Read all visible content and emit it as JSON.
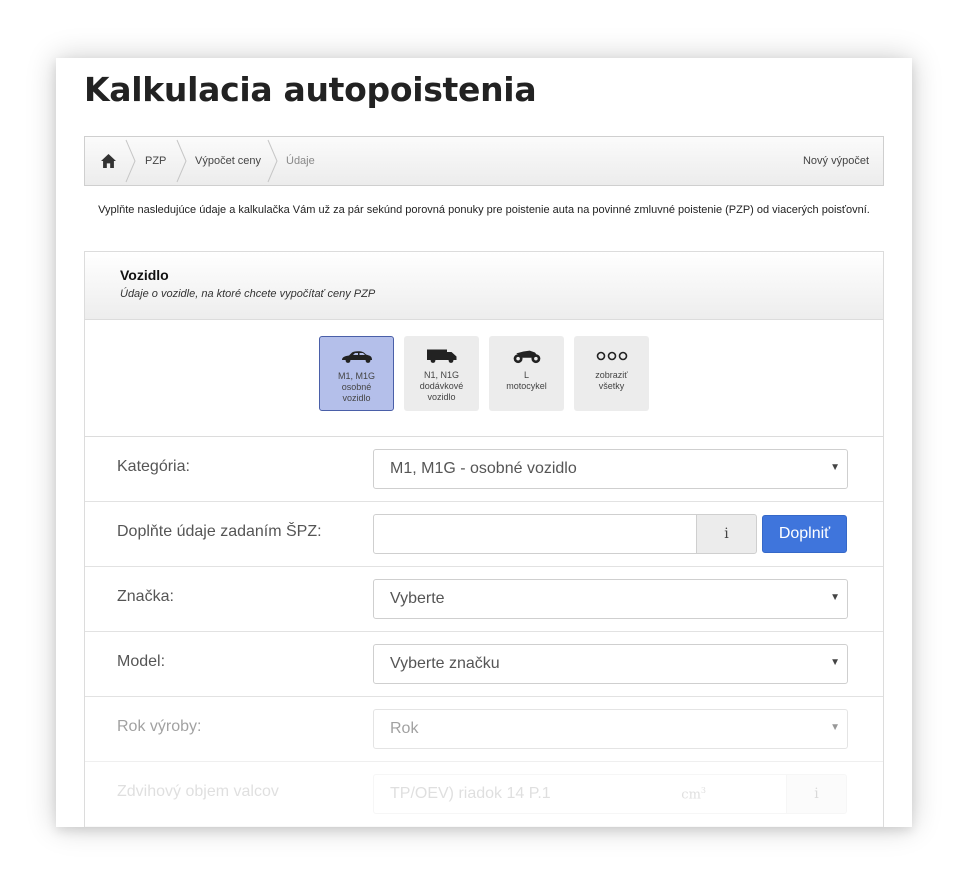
{
  "page": {
    "title": "Kalkulacia autopoistenia"
  },
  "breadcrumb": {
    "items": [
      "PZP",
      "Výpočet ceny",
      "Údaje"
    ],
    "new_calc": "Nový výpočet"
  },
  "intro": "Vyplňte nasledujúce údaje a kalkulačka Vám už za pár sekúnd porovná ponuky pre poistenie auta na povinné zmluvné poistenie (PZP) od viacerých poisťovní.",
  "section": {
    "title": "Vozidlo",
    "subtitle": "Údaje o vozidle, na ktoré chcete vypočítať ceny PZP"
  },
  "vehicle_types": [
    {
      "line1": "M1, M1G",
      "line2": "osobné",
      "line3": "vozidlo",
      "icon": "car-icon",
      "active": true
    },
    {
      "line1": "N1, N1G",
      "line2": "dodávkové",
      "line3": "vozidlo",
      "icon": "van-icon",
      "active": false
    },
    {
      "line1": "L",
      "line2": "motocykel",
      "line3": "",
      "icon": "motorcycle-icon",
      "active": false
    },
    {
      "line1": "zobraziť",
      "line2": "všetky",
      "line3": "",
      "icon": "more-icon",
      "active": false
    }
  ],
  "form": {
    "category_label": "Kategória:",
    "category_value": "M1, M1G - osobné vozidlo",
    "spz_label": "Doplňte údaje zadaním ŠPZ:",
    "spz_value": "",
    "info_button": "i",
    "fill_button": "Doplniť",
    "brand_label": "Značka:",
    "brand_value": "Vyberte",
    "model_label": "Model:",
    "model_value": "Vyberte značku",
    "year_label": "Rok výroby:",
    "year_value": "Rok",
    "engine_label": "Zdvihový objem valcov",
    "engine_placeholder": "TP/OEV) riadok 14 P.1",
    "engine_unit": "cm",
    "engine_unit_sup": "3"
  },
  "colors": {
    "accent_button": "#3f75dc",
    "active_tile": "#b4bfea",
    "active_tile_border": "#4a5fa8"
  }
}
